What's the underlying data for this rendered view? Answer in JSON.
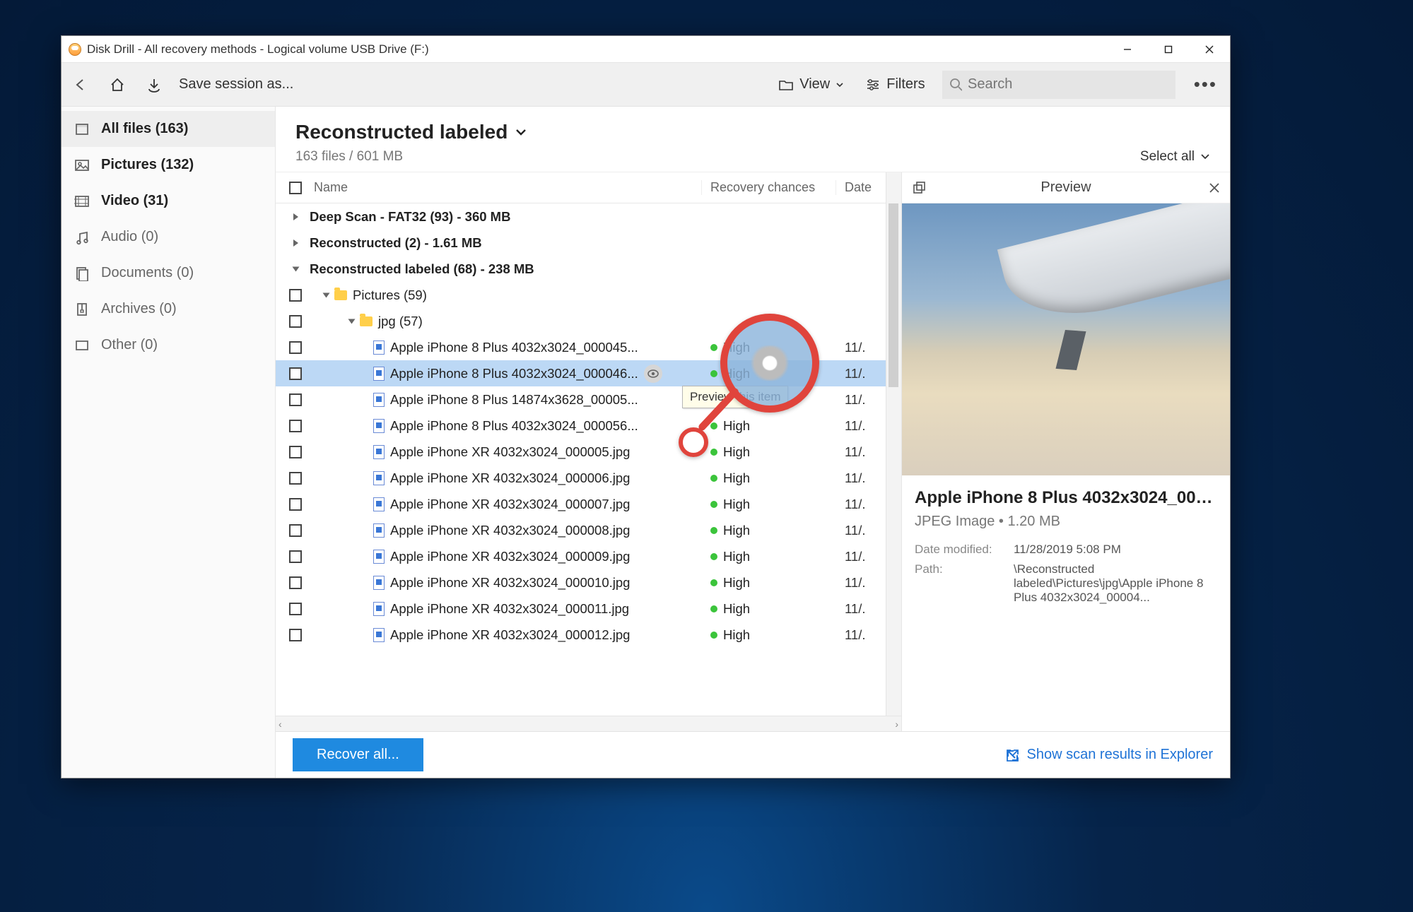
{
  "titlebar": {
    "title": "Disk Drill - All recovery methods - Logical volume USB Drive (F:)"
  },
  "toolbar": {
    "save_session": "Save session as...",
    "view_label": "View",
    "filters_label": "Filters",
    "search_placeholder": "Search"
  },
  "sidebar": {
    "items": [
      {
        "label": "All files (163)",
        "icon": "allfiles",
        "bold": true,
        "active": true
      },
      {
        "label": "Pictures (132)",
        "icon": "pictures",
        "bold": true
      },
      {
        "label": "Video (31)",
        "icon": "video",
        "bold": true
      },
      {
        "label": "Audio (0)",
        "icon": "audio"
      },
      {
        "label": "Documents (0)",
        "icon": "documents"
      },
      {
        "label": "Archives (0)",
        "icon": "archives"
      },
      {
        "label": "Other (0)",
        "icon": "other"
      }
    ]
  },
  "main": {
    "heading": "Reconstructed labeled",
    "subline": "163 files / 601 MB",
    "select_all": "Select all",
    "columns": {
      "name": "Name",
      "recovery": "Recovery chances",
      "date": "Date"
    },
    "groups": [
      {
        "label": "Deep Scan - FAT32 (93) - 360 MB",
        "expanded": false
      },
      {
        "label": "Reconstructed (2) - 1.61 MB",
        "expanded": false
      },
      {
        "label": "Reconstructed labeled (68) - 238 MB",
        "expanded": true
      }
    ],
    "folders": {
      "pictures": "Pictures (59)",
      "jpg": "jpg (57)"
    },
    "files": [
      {
        "name": "Apple iPhone 8 Plus 4032x3024_000045...",
        "rec": "High",
        "date": "11/.",
        "selected": false
      },
      {
        "name": "Apple iPhone 8 Plus 4032x3024_000046...",
        "rec": "High",
        "date": "11/.",
        "selected": true,
        "showEye": true
      },
      {
        "name": "Apple iPhone 8 Plus 14874x3628_00005...",
        "rec": "",
        "date": "11/.",
        "selected": false
      },
      {
        "name": "Apple iPhone 8 Plus 4032x3024_000056...",
        "rec": "High",
        "date": "11/.",
        "selected": false
      },
      {
        "name": "Apple iPhone XR 4032x3024_000005.jpg",
        "rec": "High",
        "date": "11/.",
        "selected": false
      },
      {
        "name": "Apple iPhone XR 4032x3024_000006.jpg",
        "rec": "High",
        "date": "11/.",
        "selected": false
      },
      {
        "name": "Apple iPhone XR 4032x3024_000007.jpg",
        "rec": "High",
        "date": "11/.",
        "selected": false
      },
      {
        "name": "Apple iPhone XR 4032x3024_000008.jpg",
        "rec": "High",
        "date": "11/.",
        "selected": false
      },
      {
        "name": "Apple iPhone XR 4032x3024_000009.jpg",
        "rec": "High",
        "date": "11/.",
        "selected": false
      },
      {
        "name": "Apple iPhone XR 4032x3024_000010.jpg",
        "rec": "High",
        "date": "11/.",
        "selected": false
      },
      {
        "name": "Apple iPhone XR 4032x3024_000011.jpg",
        "rec": "High",
        "date": "11/.",
        "selected": false
      },
      {
        "name": "Apple iPhone XR 4032x3024_000012.jpg",
        "rec": "High",
        "date": "11/.",
        "selected": false
      }
    ],
    "tooltip": "Preview this item"
  },
  "preview": {
    "header": "Preview",
    "filename": "Apple iPhone 8 Plus 4032x3024_0000...",
    "type_size": "JPEG Image • 1.20 MB",
    "date_label": "Date modified:",
    "date_value": "11/28/2019 5:08 PM",
    "path_label": "Path:",
    "path_value": "\\Reconstructed labeled\\Pictures\\jpg\\Apple iPhone 8 Plus 4032x3024_00004..."
  },
  "bottom": {
    "recover": "Recover all...",
    "explorer": "Show scan results in Explorer"
  }
}
